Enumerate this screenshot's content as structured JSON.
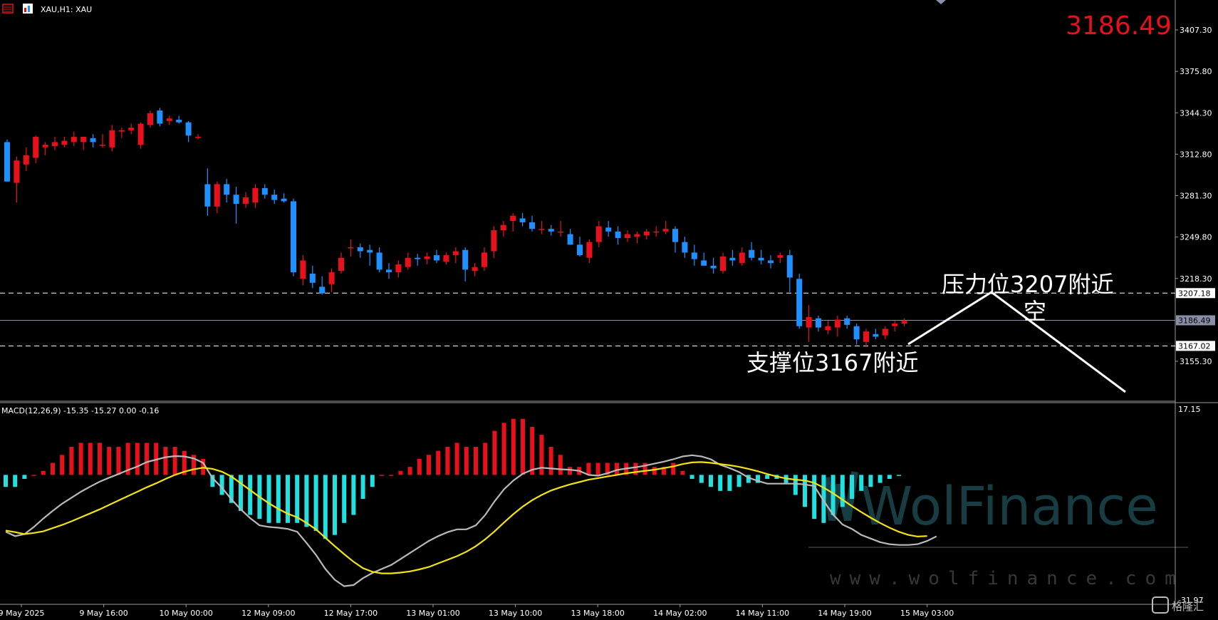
{
  "header": {
    "symbol_label": "XAU,H1:  XAU",
    "current_price": "3186.49"
  },
  "price_axis": {
    "ticks": [
      "3407.30",
      "3375.80",
      "3344.30",
      "3312.80",
      "3281.30",
      "3249.80",
      "3218.30",
      "3155.30"
    ],
    "tick_values": [
      3407.3,
      3375.8,
      3344.3,
      3312.8,
      3281.3,
      3249.8,
      3218.3,
      3155.3
    ],
    "tags": [
      {
        "label": "3207.18",
        "value": 3207.18,
        "style": "dashed",
        "color": "#ffffff"
      },
      {
        "label": "3186.49",
        "value": 3186.49,
        "style": "solid",
        "color": "#8a8fa8"
      },
      {
        "label": "3167.02",
        "value": 3167.02,
        "style": "dashed",
        "color": "#ffffff"
      }
    ]
  },
  "macd_axis": {
    "top_label": "17.15",
    "bottom_label": "-31.97"
  },
  "time_axis": {
    "labels": [
      "9 May 2025",
      "9 May 16:00",
      "10 May 00:00",
      "12 May 09:00",
      "12 May 17:00",
      "13 May 01:00",
      "13 May 10:00",
      "13 May 18:00",
      "14 May 02:00",
      "14 May 11:00",
      "14 May 19:00",
      "15 May 03:00"
    ]
  },
  "annotations": {
    "resistance": "压力位3207附近",
    "short": "空",
    "support": "支撑位3167附近"
  },
  "watermark": {
    "brand": "WolFinance",
    "url": "www.wolfinance.com",
    "logo": "格隆汇"
  },
  "colors": {
    "up": "#e8101a",
    "down": "#1e90ff",
    "hist_pos": "#e8101a",
    "hist_neg": "#22e0e0",
    "macd_line": "#b9b9b9",
    "signal_line": "#f2e313",
    "bid_line": "#8a8fa8"
  },
  "chart_data": [
    {
      "type": "candlestick",
      "title": "XAU,H1:  XAU",
      "ylim": [
        3130,
        3420
      ],
      "candles": [
        [
          3322,
          3324,
          3292,
          3292
        ],
        [
          3291,
          3311,
          3276,
          3308
        ],
        [
          3305,
          3318,
          3300,
          3312
        ],
        [
          3310,
          3327,
          3306,
          3326
        ],
        [
          3318,
          3322,
          3312,
          3320
        ],
        [
          3319,
          3326,
          3316,
          3322
        ],
        [
          3320,
          3326,
          3318,
          3323
        ],
        [
          3322,
          3330,
          3319,
          3326
        ],
        [
          3322,
          3326,
          3316,
          3326
        ],
        [
          3325,
          3328,
          3318,
          3322
        ],
        [
          3320,
          3328,
          3318,
          3320
        ],
        [
          3318,
          3335,
          3315,
          3331
        ],
        [
          3330,
          3333,
          3325,
          3331
        ],
        [
          3331,
          3336,
          3328,
          3333
        ],
        [
          3320,
          3337,
          3317,
          3336
        ],
        [
          3335,
          3346,
          3333,
          3344
        ],
        [
          3346,
          3348,
          3334,
          3336
        ],
        [
          3338,
          3342,
          3335,
          3340
        ],
        [
          3339,
          3342,
          3336,
          3337
        ],
        [
          3337,
          3338,
          3322,
          3327
        ],
        [
          3326,
          3328,
          3324,
          3326
        ],
        [
          3290,
          3302,
          3266,
          3273
        ],
        [
          3273,
          3292,
          3268,
          3290
        ],
        [
          3290,
          3294,
          3276,
          3282
        ],
        [
          3282,
          3288,
          3260,
          3275
        ],
        [
          3275,
          3284,
          3272,
          3280
        ],
        [
          3276,
          3290,
          3272,
          3287
        ],
        [
          3287,
          3290,
          3279,
          3282
        ],
        [
          3282,
          3286,
          3275,
          3278
        ],
        [
          3279,
          3283,
          3276,
          3277
        ],
        [
          3277,
          3279,
          3220,
          3223
        ],
        [
          3218,
          3236,
          3213,
          3232
        ],
        [
          3222,
          3228,
          3211,
          3215
        ],
        [
          3212,
          3220,
          3206,
          3207
        ],
        [
          3214,
          3226,
          3208,
          3223
        ],
        [
          3224,
          3238,
          3222,
          3234
        ],
        [
          3242,
          3248,
          3235,
          3242
        ],
        [
          3242,
          3245,
          3234,
          3239
        ],
        [
          3240,
          3244,
          3228,
          3238
        ],
        [
          3238,
          3242,
          3223,
          3225
        ],
        [
          3225,
          3230,
          3218,
          3223
        ],
        [
          3223,
          3232,
          3219,
          3229
        ],
        [
          3227,
          3238,
          3225,
          3234
        ],
        [
          3234,
          3237,
          3228,
          3233
        ],
        [
          3233,
          3238,
          3229,
          3235
        ],
        [
          3236,
          3240,
          3230,
          3232
        ],
        [
          3231,
          3238,
          3229,
          3236
        ],
        [
          3236,
          3242,
          3230,
          3239
        ],
        [
          3240,
          3242,
          3216,
          3225
        ],
        [
          3224,
          3230,
          3220,
          3227
        ],
        [
          3227,
          3242,
          3224,
          3238
        ],
        [
          3239,
          3258,
          3234,
          3255
        ],
        [
          3255,
          3262,
          3250,
          3259
        ],
        [
          3262,
          3268,
          3254,
          3266
        ],
        [
          3264,
          3268,
          3258,
          3261
        ],
        [
          3261,
          3266,
          3254,
          3256
        ],
        [
          3256,
          3262,
          3252,
          3256
        ],
        [
          3256,
          3259,
          3251,
          3254
        ],
        [
          3254,
          3262,
          3250,
          3254
        ],
        [
          3252,
          3256,
          3244,
          3244
        ],
        [
          3244,
          3250,
          3235,
          3236
        ],
        [
          3234,
          3248,
          3230,
          3246
        ],
        [
          3246,
          3262,
          3242,
          3258
        ],
        [
          3257,
          3262,
          3250,
          3254
        ],
        [
          3254,
          3258,
          3244,
          3249
        ],
        [
          3249,
          3255,
          3246,
          3252
        ],
        [
          3250,
          3254,
          3245,
          3252
        ],
        [
          3251,
          3256,
          3248,
          3254
        ],
        [
          3254,
          3258,
          3250,
          3254
        ],
        [
          3254,
          3262,
          3252,
          3256
        ],
        [
          3256,
          3258,
          3238,
          3246
        ],
        [
          3246,
          3250,
          3234,
          3238
        ],
        [
          3238,
          3244,
          3228,
          3233
        ],
        [
          3232,
          3238,
          3228,
          3228
        ],
        [
          3228,
          3234,
          3222,
          3226
        ],
        [
          3224,
          3238,
          3222,
          3235
        ],
        [
          3234,
          3240,
          3228,
          3232
        ],
        [
          3230,
          3242,
          3228,
          3238
        ],
        [
          3240,
          3246,
          3232,
          3234
        ],
        [
          3234,
          3240,
          3229,
          3232
        ],
        [
          3232,
          3236,
          3226,
          3230
        ],
        [
          3234,
          3238,
          3230,
          3236
        ],
        [
          3236,
          3240,
          3208,
          3219
        ],
        [
          3218,
          3222,
          3180,
          3182
        ],
        [
          3181,
          3198,
          3170,
          3189
        ],
        [
          3188,
          3190,
          3178,
          3181
        ],
        [
          3179,
          3186,
          3176,
          3182
        ],
        [
          3181,
          3190,
          3174,
          3187
        ],
        [
          3188,
          3190,
          3180,
          3183
        ],
        [
          3182,
          3184,
          3168,
          3172
        ],
        [
          3170,
          3180,
          3166,
          3178
        ],
        [
          3176,
          3180,
          3172,
          3174
        ],
        [
          3175,
          3182,
          3172,
          3180
        ],
        [
          3182,
          3186,
          3178,
          3184
        ],
        [
          3184,
          3188,
          3182,
          3186
        ]
      ]
    },
    {
      "type": "bar",
      "title": "MACD(12,26,9) -15.35 -15.27 0.00 -0.16",
      "ylim": [
        -31.97,
        17.15
      ],
      "histogram": [
        -3,
        -3,
        -1,
        0,
        1,
        3,
        5,
        7,
        8,
        8,
        8,
        7,
        7,
        8,
        8,
        8,
        8,
        7,
        7,
        6,
        5,
        4,
        -3,
        -5,
        -7,
        -9,
        -10,
        -11,
        -12,
        -12,
        -12,
        -12,
        -13,
        -14,
        -16,
        -15,
        -12,
        -10,
        -6,
        -3,
        0,
        0,
        1,
        2,
        4,
        5,
        6,
        7,
        8,
        7,
        7,
        8,
        11,
        13,
        14,
        14,
        12,
        10,
        7,
        5,
        2,
        2,
        3,
        3,
        3,
        3,
        3,
        3,
        3,
        2,
        2,
        3,
        1,
        -1,
        -2,
        -3,
        -4,
        -4,
        -3,
        -2,
        -2,
        -1,
        -1,
        -2,
        -5,
        -8,
        -11,
        -12,
        -10,
        -8,
        -6,
        -4,
        -3,
        -2,
        -1,
        -0.16
      ],
      "macd": [
        -14.2,
        -15.3,
        -14.8,
        -13.0,
        -10.9,
        -9.0,
        -7.2,
        -5.7,
        -4.2,
        -2.9,
        -1.7,
        -0.7,
        0.2,
        1.2,
        2.1,
        3.2,
        3.8,
        4.4,
        4.7,
        4.6,
        4.1,
        3.0,
        -0.8,
        -3.2,
        -6.1,
        -8.6,
        -10.8,
        -12.6,
        -13.0,
        -13.2,
        -13.5,
        -14.2,
        -17.0,
        -20.0,
        -23.5,
        -26.2,
        -27.8,
        -27.5,
        -25.8,
        -24.5,
        -23.5,
        -22.5,
        -21.0,
        -19.5,
        -18.0,
        -16.5,
        -15.3,
        -14.3,
        -13.6,
        -13.6,
        -12.6,
        -10.0,
        -6.6,
        -3.6,
        -1.4,
        0.3,
        1.3,
        1.8,
        1.6,
        1.4,
        1.3,
        1.0,
        0.0,
        -0.2,
        0.4,
        1.2,
        1.6,
        1.9,
        2.3,
        2.8,
        3.3,
        3.9,
        4.6,
        4.9,
        4.6,
        3.9,
        2.5,
        1.7,
        0.7,
        -0.7,
        -1.5,
        -2.2,
        -2.2,
        -2.2,
        -2.2,
        -2.4,
        -2.8,
        -6.5,
        -9.9,
        -12.4,
        -13.5,
        -15.0,
        -15.9,
        -16.8,
        -17.3,
        -17.5,
        -17.5,
        -17.3,
        -16.5,
        -15.35
      ],
      "signal": [
        -13.9,
        -14.3,
        -14.8,
        -14.5,
        -14.1,
        -13.3,
        -12.5,
        -11.6,
        -10.6,
        -9.6,
        -8.6,
        -7.5,
        -6.4,
        -5.3,
        -4.2,
        -3.1,
        -2.1,
        -1.0,
        0.0,
        0.8,
        1.4,
        1.8,
        1.5,
        0.8,
        -0.4,
        -2.1,
        -3.8,
        -5.5,
        -7.1,
        -8.5,
        -9.7,
        -10.6,
        -12.0,
        -13.6,
        -15.7,
        -17.8,
        -19.8,
        -21.7,
        -23.3,
        -24.2,
        -24.6,
        -24.6,
        -24.4,
        -24.1,
        -23.6,
        -23.0,
        -22.1,
        -21.2,
        -20.3,
        -19.2,
        -17.8,
        -16.1,
        -14.1,
        -11.9,
        -9.8,
        -7.9,
        -6.3,
        -5.0,
        -3.9,
        -3.1,
        -2.4,
        -1.8,
        -1.2,
        -0.8,
        -0.4,
        0.0,
        0.4,
        0.7,
        1.0,
        1.3,
        1.7,
        2.1,
        2.7,
        3.1,
        3.2,
        3.0,
        2.7,
        2.4,
        2.0,
        1.5,
        0.9,
        0.2,
        -0.4,
        -0.9,
        -1.2,
        -1.4,
        -2.0,
        -3.2,
        -4.6,
        -6.2,
        -7.8,
        -9.3,
        -10.7,
        -12.0,
        -13.2,
        -14.2,
        -15.0,
        -15.4,
        -15.27
      ]
    }
  ]
}
